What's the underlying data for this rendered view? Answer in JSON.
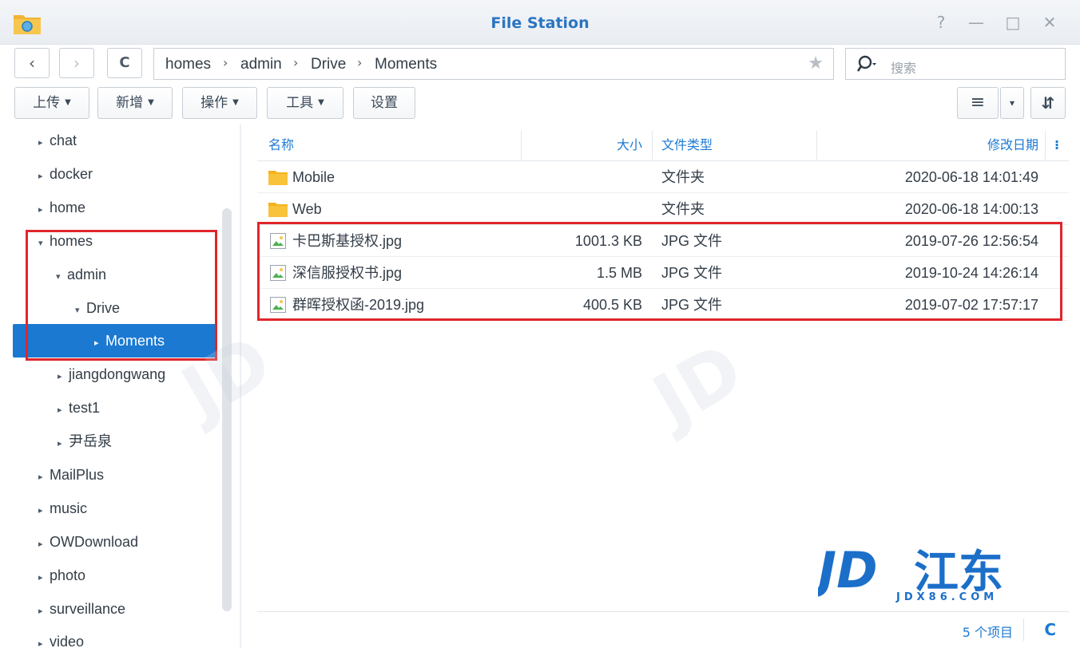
{
  "window": {
    "title": "File Station",
    "help": "?",
    "minimize": "—",
    "maximize": "□",
    "close": "✕"
  },
  "nav": {
    "back": "‹",
    "forward": "›",
    "refresh": "C",
    "breadcrumb": [
      "homes",
      "admin",
      "Drive",
      "Moments"
    ],
    "sep": "›",
    "star": "★",
    "search_placeholder": "搜索"
  },
  "toolbar": {
    "upload": "上传",
    "create": "新增",
    "action": "操作",
    "tools": "工具",
    "settings": "设置",
    "view_list": "≡",
    "view_dropdown": "▾",
    "sort": "⇵"
  },
  "sidebar": {
    "items": [
      {
        "label": "chat",
        "arrow": "▸"
      },
      {
        "label": "docker",
        "arrow": "▸"
      },
      {
        "label": "home",
        "arrow": "▸"
      },
      {
        "label": "homes",
        "arrow": "▾"
      },
      {
        "label": "admin",
        "arrow": "▾"
      },
      {
        "label": "Drive",
        "arrow": "▾"
      },
      {
        "label": "Moments",
        "arrow": "▸"
      },
      {
        "label": "jiangdongwang",
        "arrow": "▸"
      },
      {
        "label": "test1",
        "arrow": "▸"
      },
      {
        "label": "尹岳泉",
        "arrow": "▸"
      },
      {
        "label": "MailPlus",
        "arrow": "▸"
      },
      {
        "label": "music",
        "arrow": "▸"
      },
      {
        "label": "OWDownload",
        "arrow": "▸"
      },
      {
        "label": "photo",
        "arrow": "▸"
      },
      {
        "label": "surveillance",
        "arrow": "▸"
      },
      {
        "label": "video",
        "arrow": "▸"
      }
    ]
  },
  "filelist": {
    "columns": {
      "name": "名称",
      "size": "大小",
      "type": "文件类型",
      "modified": "修改日期",
      "more": "⁝"
    },
    "rows": [
      {
        "name": "Mobile",
        "size": "",
        "type": "文件夹",
        "modified": "2020-06-18 14:01:49",
        "icon": "folder-icon"
      },
      {
        "name": "Web",
        "size": "",
        "type": "文件夹",
        "modified": "2020-06-18 14:00:13",
        "icon": "folder-icon"
      },
      {
        "name": "卡巴斯基授权.jpg",
        "size": "1001.3 KB",
        "type": "JPG 文件",
        "modified": "2019-07-26 12:56:54",
        "icon": "image-file-icon"
      },
      {
        "name": "深信服授权书.jpg",
        "size": "1.5 MB",
        "type": "JPG 文件",
        "modified": "2019-10-24 14:26:14",
        "icon": "image-file-icon"
      },
      {
        "name": "群晖授权函-2019.jpg",
        "size": "400.5 KB",
        "type": "JPG 文件",
        "modified": "2019-07-02 17:57:17",
        "icon": "image-file-icon"
      }
    ]
  },
  "footer": {
    "count": "5 个项目",
    "refresh": "C"
  },
  "watermark": {
    "brand": "JD江东",
    "domain": "JDX86.COM"
  },
  "colors": {
    "accent": "#1b79d1",
    "highlight": "#e0262a",
    "folder": "#f5b21b"
  }
}
